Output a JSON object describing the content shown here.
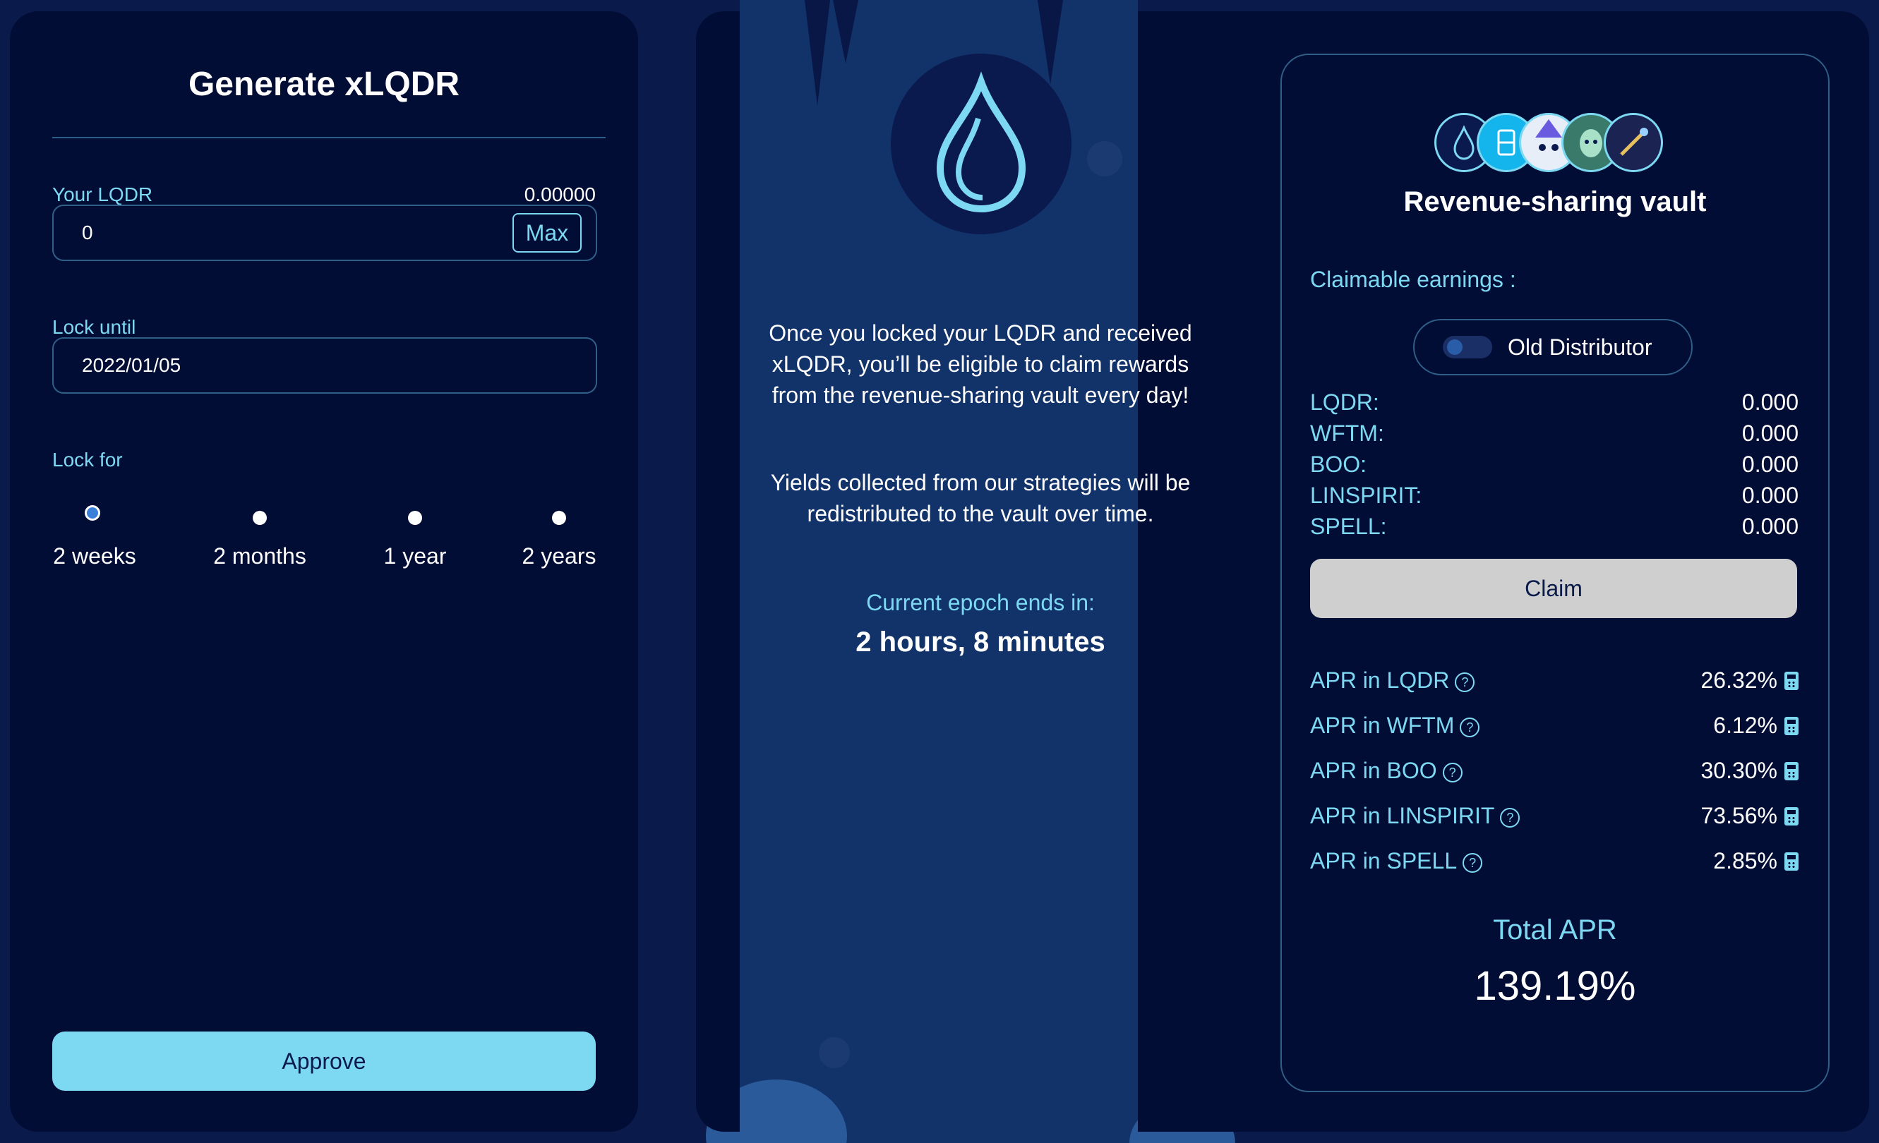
{
  "left": {
    "title": "Generate xLQDR",
    "lqdr_label": "Your LQDR",
    "lqdr_balance": "0.00000",
    "amount_value": "0",
    "max_label": "Max",
    "lock_until_label": "Lock until",
    "lock_until_value": "2022/01/05",
    "lock_for_label": "Lock for",
    "options": [
      {
        "label": "2 weeks",
        "selected": true
      },
      {
        "label": "2 months",
        "selected": false
      },
      {
        "label": "1 year",
        "selected": false
      },
      {
        "label": "2 years",
        "selected": false
      }
    ],
    "approve_label": "Approve"
  },
  "center": {
    "icon": "flame-drop-icon",
    "paragraph1_line1": "Once you locked your LQDR and received",
    "paragraph1_line2": "xLQDR, you’ll be eligible to claim rewards",
    "paragraph1_line3": "from the revenue-sharing vault every day!",
    "paragraph2_line1": "Yields collected from our strategies will be",
    "paragraph2_line2": "redistributed to the vault over time.",
    "epoch_label": "Current epoch ends in:",
    "epoch_value": "2 hours, 8 minutes"
  },
  "vault": {
    "token_icons": [
      "lqdr-icon",
      "wftm-icon",
      "boo-icon",
      "linspirit-icon",
      "spell-icon"
    ],
    "title": "Revenue-sharing vault",
    "claimable_label": "Claimable earnings :",
    "distributor_label": "Old Distributor",
    "earnings": [
      {
        "token": "LQDR:",
        "amount": "0.000"
      },
      {
        "token": "WFTM:",
        "amount": "0.000"
      },
      {
        "token": "BOO:",
        "amount": "0.000"
      },
      {
        "token": "LINSPIRIT:",
        "amount": "0.000"
      },
      {
        "token": "SPELL:",
        "amount": "0.000"
      }
    ],
    "claim_label": "Claim",
    "aprs": [
      {
        "label": "APR in LQDR",
        "value": "26.32%"
      },
      {
        "label": "APR in WFTM",
        "value": "6.12%"
      },
      {
        "label": "APR in BOO",
        "value": "30.30%"
      },
      {
        "label": "APR in LINSPIRIT",
        "value": "73.56%"
      },
      {
        "label": "APR in SPELL",
        "value": "2.85%"
      }
    ],
    "total_label": "Total APR",
    "total_value": "139.19%"
  },
  "colors": {
    "accent": "#7dd8f2",
    "panel": "#020d35",
    "background": "#0a1a4a"
  }
}
